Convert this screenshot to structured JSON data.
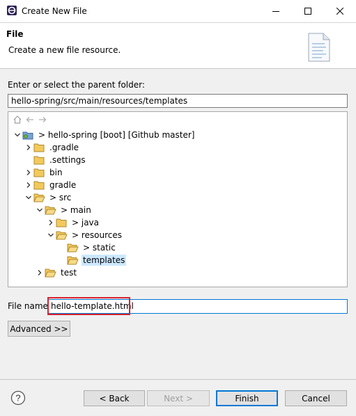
{
  "window": {
    "title": "Create New File",
    "minimize": "—",
    "maximize": "☐",
    "close": "✕"
  },
  "header": {
    "title": "File",
    "description": "Create a new file resource."
  },
  "parent_folder": {
    "label": "Enter or select the parent folder:",
    "value": "hello-spring/src/main/resources/templates"
  },
  "tree": {
    "items": [
      {
        "label": "> hello-spring [boot] [Github master]",
        "expanded": true,
        "selected": false
      },
      {
        "label": ".gradle",
        "expanded": false,
        "selected": false
      },
      {
        "label": ".settings",
        "expanded": false,
        "selected": false
      },
      {
        "label": "bin",
        "expanded": false,
        "selected": false
      },
      {
        "label": "gradle",
        "expanded": false,
        "selected": false
      },
      {
        "label": "> src",
        "expanded": true,
        "selected": false
      },
      {
        "label": "> main",
        "expanded": true,
        "selected": false
      },
      {
        "label": "> java",
        "expanded": false,
        "selected": false
      },
      {
        "label": "> resources",
        "expanded": true,
        "selected": false
      },
      {
        "label": "> static",
        "expanded": false,
        "selected": false
      },
      {
        "label": "templates",
        "expanded": false,
        "selected": true
      },
      {
        "label": "test",
        "expanded": false,
        "selected": false
      }
    ]
  },
  "file_name": {
    "label": "File name:",
    "value": "hello-template.html"
  },
  "buttons": {
    "advanced": "Advanced >>",
    "back": "< Back",
    "next": "Next >",
    "finish": "Finish",
    "cancel": "Cancel"
  },
  "colors": {
    "accent": "#0078d7",
    "highlight": "#d9232d",
    "selection": "#cce8ff",
    "folder": "#e8b84a"
  }
}
